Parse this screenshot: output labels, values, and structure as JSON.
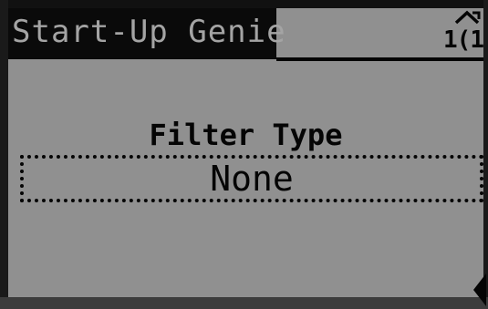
{
  "header": {
    "title": "Start-Up Genie",
    "page_number": "1(1",
    "page_indicator_icon": "up-arrow-icon"
  },
  "parameter": {
    "label": "Filter Type",
    "value": "None"
  },
  "navigation": {
    "icon": "left-right-arrow-icon"
  }
}
